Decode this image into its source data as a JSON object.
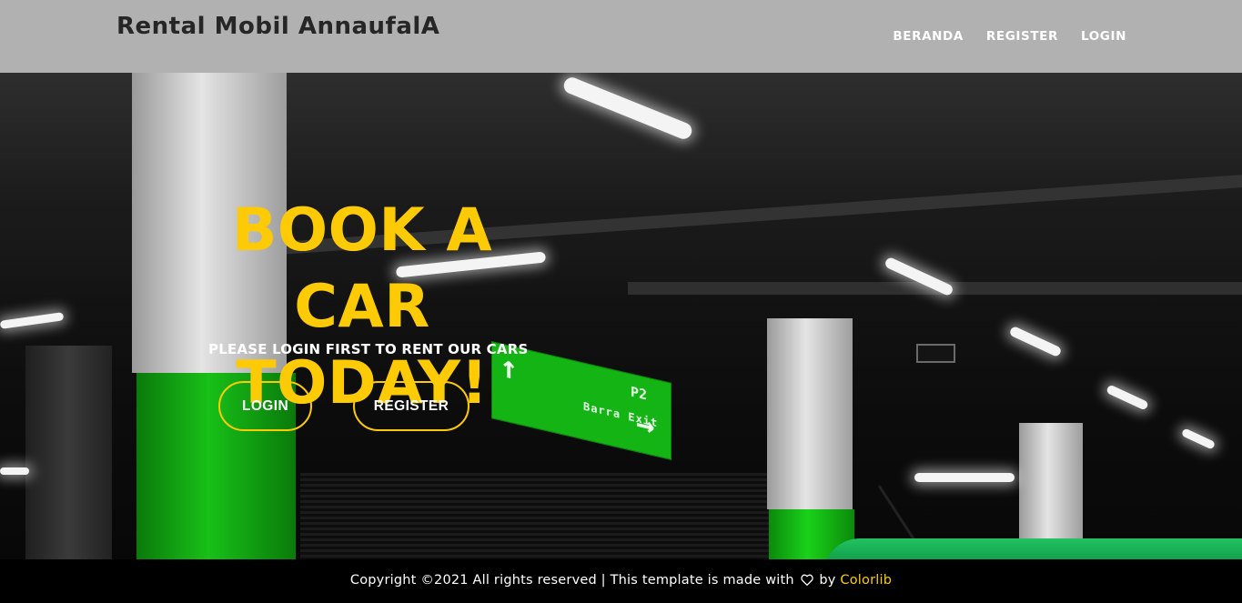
{
  "header": {
    "brand": "Rental Mobil AnnaufalA",
    "nav": [
      {
        "label": "BERANDA"
      },
      {
        "label": "REGISTER"
      },
      {
        "label": "LOGIN"
      }
    ]
  },
  "hero": {
    "title_line1": "BOOK A CAR",
    "title_line2": "TODAY!",
    "subtitle": "PLEASE LOGIN FIRST TO RENT OUR CARS",
    "login_button": "LOGIN",
    "register_button": "REGISTER",
    "sign_text": {
      "arrow_up": "↑",
      "arrow_right": "→",
      "level": "P2",
      "exit": "Barra Exit"
    }
  },
  "footer": {
    "text_before": "Copyright ©2021 All rights reserved | This template is made with",
    "text_by": "by",
    "link": "Colorlib",
    "heart_icon": "heart-outline-icon"
  },
  "colors": {
    "header_bg": "#b1b1b1",
    "accent": "#fccb06",
    "footer_bg": "#000000"
  }
}
